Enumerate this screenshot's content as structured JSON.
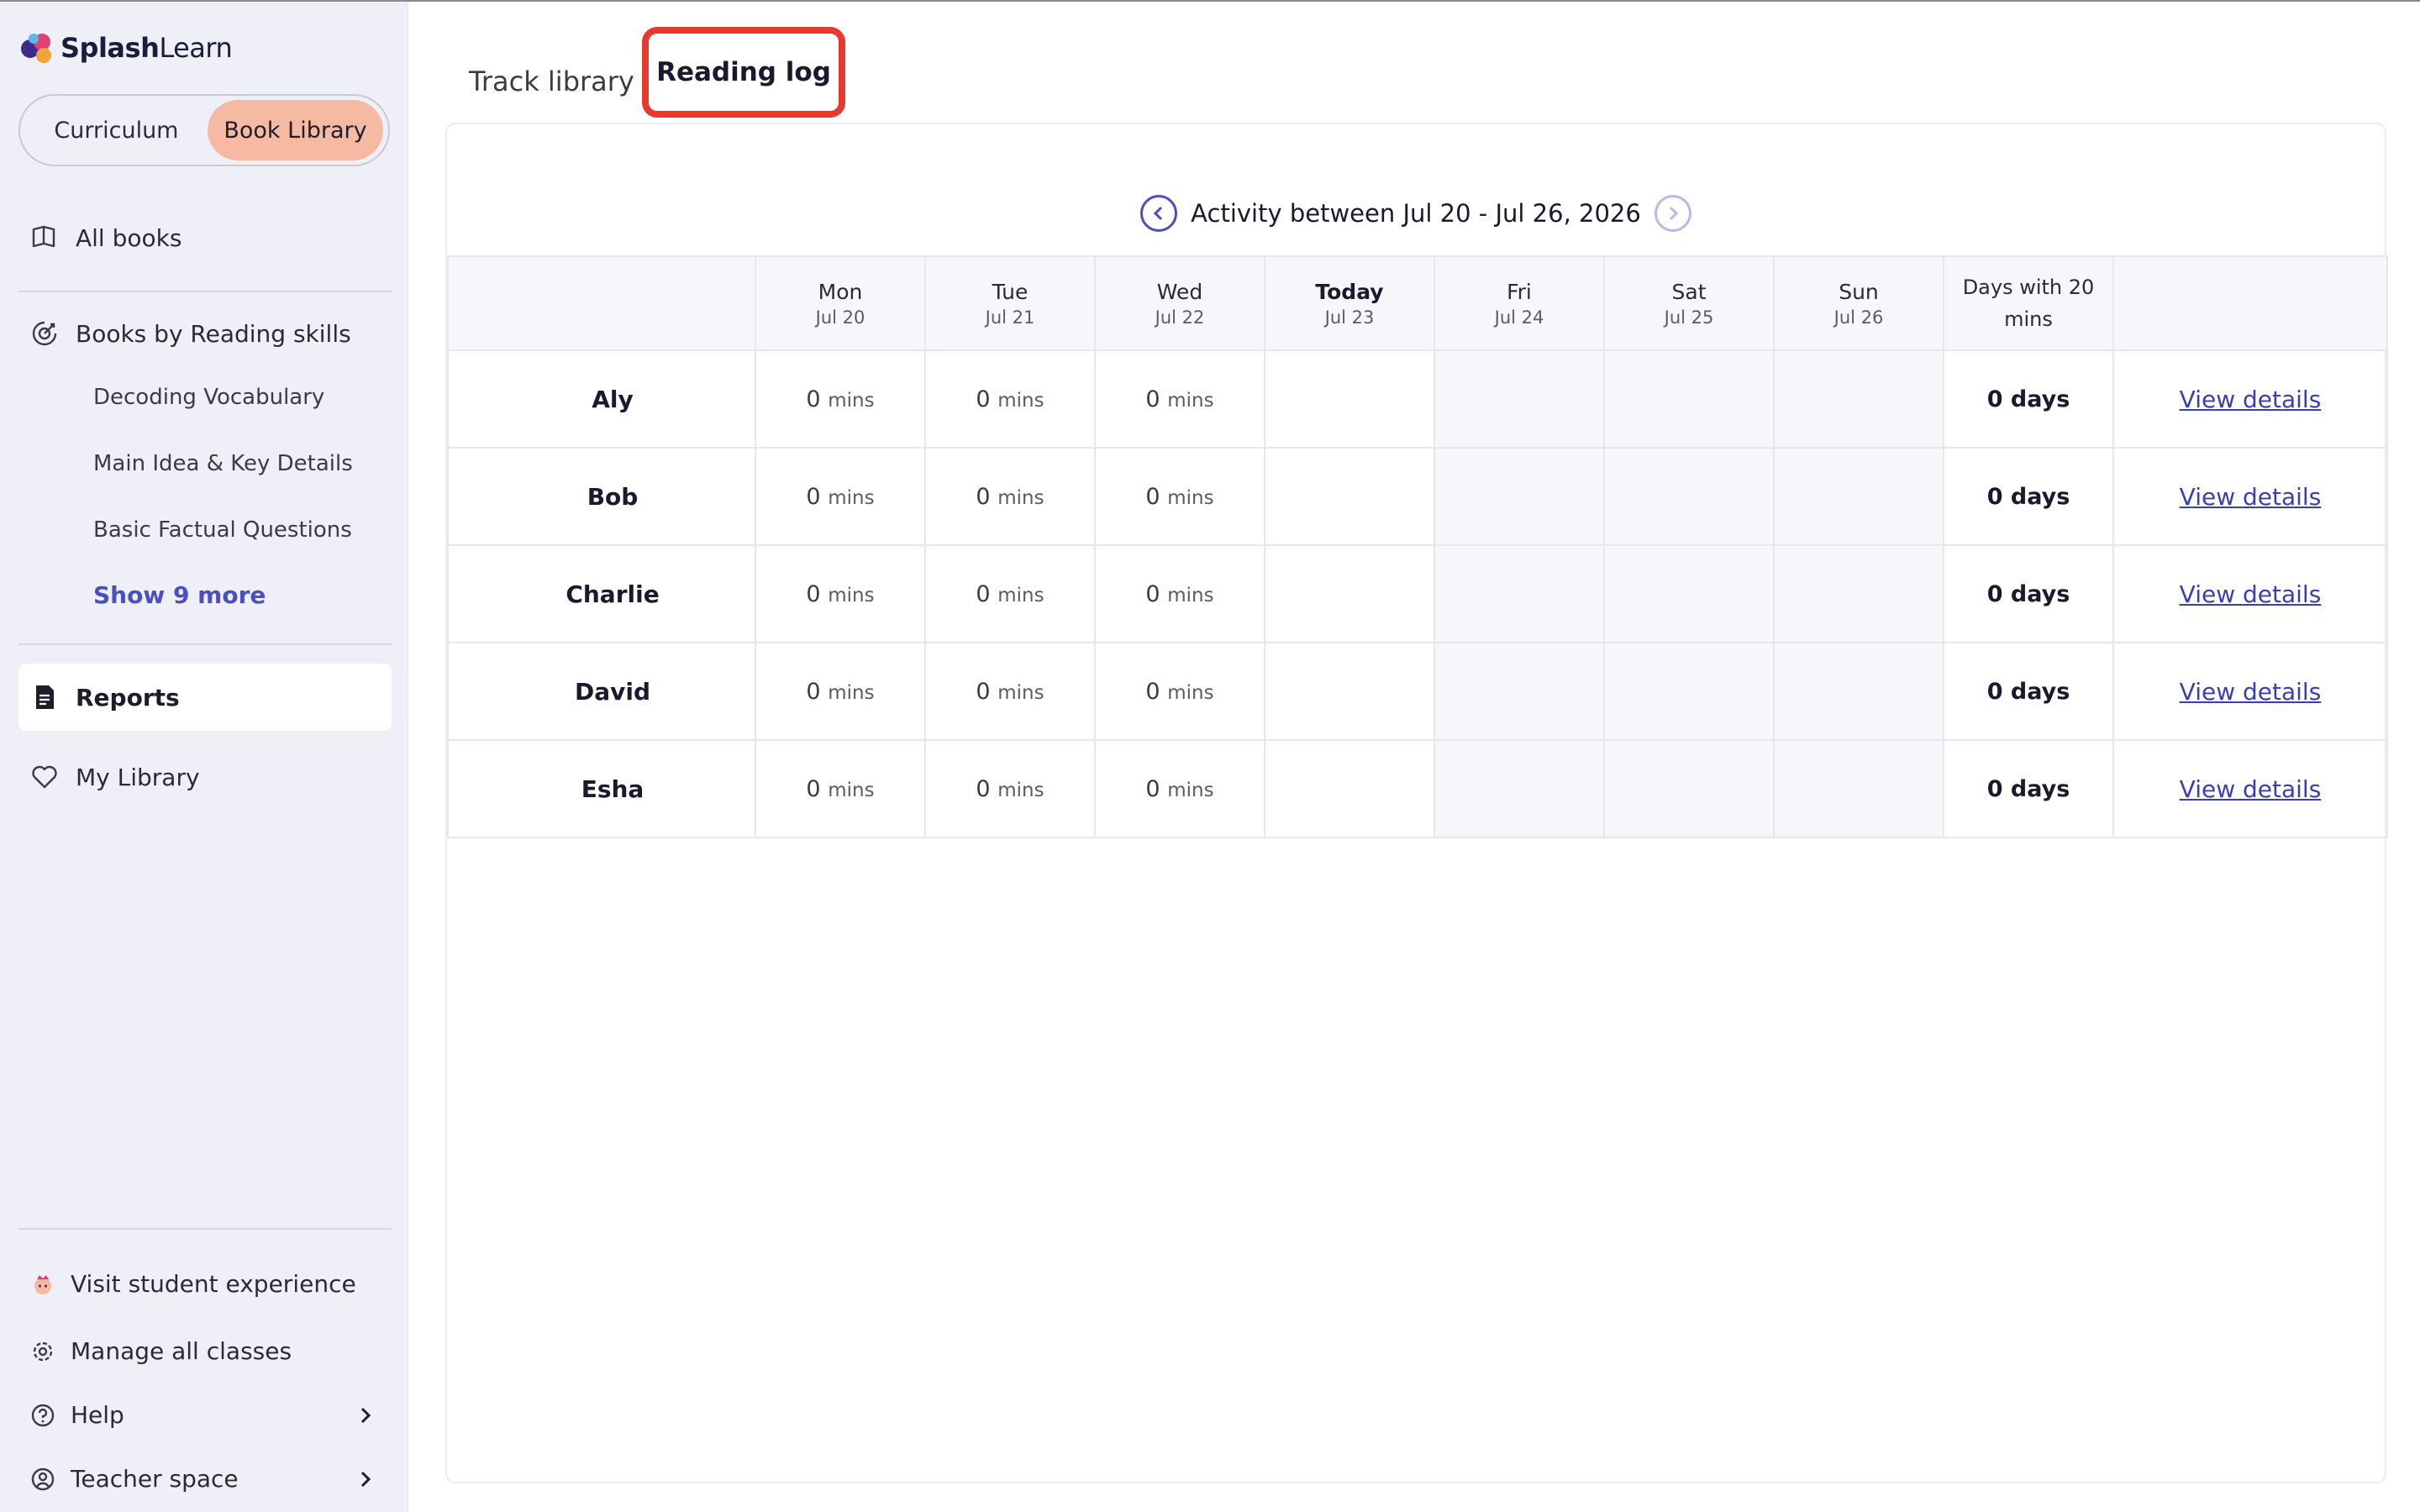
{
  "app": {
    "logo_bold": "Splash",
    "logo_light": "Learn"
  },
  "sidebar": {
    "toggle": {
      "curriculum": "Curriculum",
      "book_library": "Book Library"
    },
    "all_books": "All books",
    "books_by_skills": "Books by Reading skills",
    "sub_items": [
      "Decoding Vocabulary",
      "Main Idea & Key Details",
      "Basic Factual Questions"
    ],
    "show_more": "Show 9 more",
    "reports": "Reports",
    "my_library": "My Library",
    "visit_student": "Visit student experience",
    "manage_classes": "Manage all classes",
    "help": "Help",
    "teacher_space": "Teacher space"
  },
  "tabs": {
    "track_library": "Track library",
    "reading_log": "Reading log"
  },
  "date_nav": {
    "label": "Activity between Jul 20 - Jul 26, 2026"
  },
  "table": {
    "columns": [
      {
        "day": "Mon",
        "date": "Jul 20"
      },
      {
        "day": "Tue",
        "date": "Jul 21"
      },
      {
        "day": "Wed",
        "date": "Jul 22"
      },
      {
        "day": "Today",
        "date": "Jul 23"
      },
      {
        "day": "Fri",
        "date": "Jul 24"
      },
      {
        "day": "Sat",
        "date": "Jul 25"
      },
      {
        "day": "Sun",
        "date": "Jul 26"
      }
    ],
    "days20_header_line1": "Days with 20",
    "days20_header_line2": "mins",
    "rows": [
      {
        "name": "Aly",
        "mon": "0",
        "tue": "0",
        "wed": "0",
        "unit": "mins",
        "days": "0 days",
        "link": "View details"
      },
      {
        "name": "Bob",
        "mon": "0",
        "tue": "0",
        "wed": "0",
        "unit": "mins",
        "days": "0 days",
        "link": "View details"
      },
      {
        "name": "Charlie",
        "mon": "0",
        "tue": "0",
        "wed": "0",
        "unit": "mins",
        "days": "0 days",
        "link": "View details"
      },
      {
        "name": "David",
        "mon": "0",
        "tue": "0",
        "wed": "0",
        "unit": "mins",
        "days": "0 days",
        "link": "View details"
      },
      {
        "name": "Esha",
        "mon": "0",
        "tue": "0",
        "wed": "0",
        "unit": "mins",
        "days": "0 days",
        "link": "View details"
      }
    ]
  },
  "colors": {
    "accent": "#4b4fc0",
    "active_toggle": "#f6b9a2",
    "highlight_box": "#e8392f",
    "sidebar_bg": "#efeff8"
  }
}
